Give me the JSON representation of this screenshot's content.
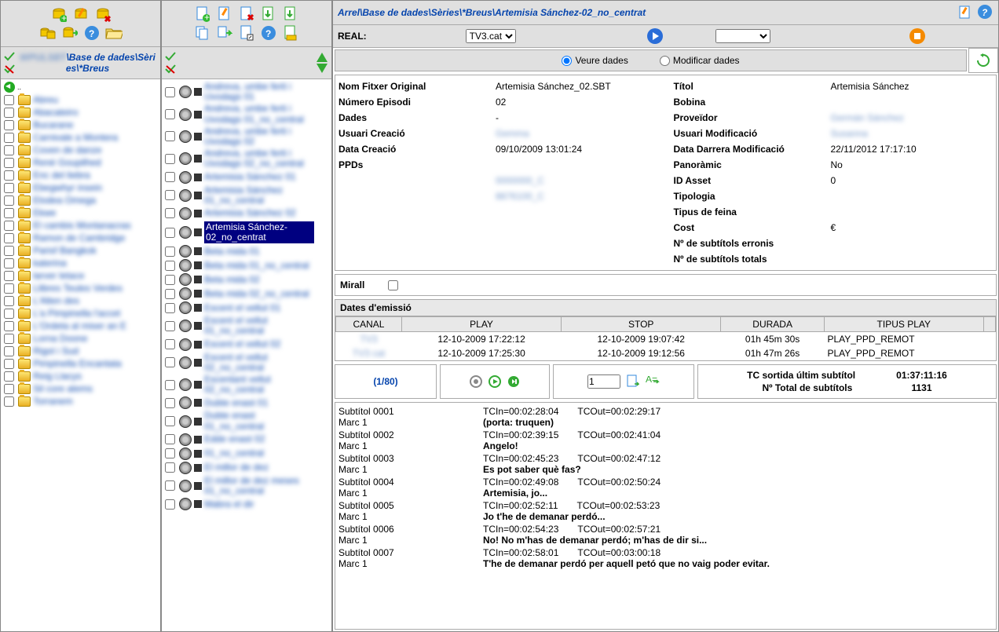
{
  "col1": {
    "path": "\\Base de dades\\Sèries\\*Breus",
    "folders": [
      "Abreu",
      "Abacateiro",
      "Bucarane",
      "Carnivale a Montera",
      "Coven de danze",
      "René Goupilhed",
      "Enc del liebra",
      "Ebegwhyr insein",
      "Elodea Omega",
      "Ekwe",
      "El cambis Montanacras",
      "Ramon de Cambridge",
      "Parisf Bangkok",
      "katerina",
      "larver letace",
      "Llibres Teules Verdes",
      "L'Alten des",
      "L'a Pimpinella l'accet",
      "L'Ordeta al miser an E",
      "Lorna Doone",
      "Rigol i Sud",
      "Pimpinella Encantata",
      "Reig Llacys",
      "Sil core atems",
      "Torranem"
    ]
  },
  "col2": {
    "items": [
      "Andreva, umbe ferti i Uvodags 01",
      "Andreva, umbe ferti i Uvodags 01_no_central",
      "Andreva, umbe ferti i Uvodags 02",
      "Andreva, umbe ferti i Uvodags 02_no_central",
      "Artemisia Sánchez 01",
      "Artemisia Sánchez 01_no_central",
      "Artemisia Sánchez 02",
      "Artemisia Sánchez-02_no_centrat",
      "Beta mida 01",
      "Beta mida 01_no_central",
      "Beta mida 02",
      "Beta mida 02_no_central",
      "Escent el vellut 01",
      "Escent el vellut 01_no_central",
      "Escent el vellut 02",
      "Escent el vellut 02_no_central",
      "Escentant vellut 02_no_central",
      "Dubte enast 01",
      "Dubte enast 01_no_central",
      "Edde enast 02",
      "01_no_central",
      "El millor de dez",
      "El millor de dez meses 01_no_central",
      "Mabra el dir"
    ],
    "selectedIndex": 7
  },
  "breadcrumb": "Arrel\\Base de dades\\Sèries\\*Breus\\Artemisia Sánchez-02_no_centrat",
  "real": {
    "label": "REAL:",
    "channel": "TV3.cat"
  },
  "viewmode": {
    "view": "Veure dades",
    "edit": "Modificar dades"
  },
  "details": {
    "left": [
      {
        "k": "Nom Fitxer Original",
        "v": "Artemisia Sánchez_02.SBT"
      },
      {
        "k": "Número Episodi",
        "v": "02"
      },
      {
        "k": "Dades",
        "v": "-"
      },
      {
        "k": "Usuari Creació",
        "v": "Gemma",
        "blur": true
      },
      {
        "k": "Data Creació",
        "v": "09/10/2009 13:01:24"
      },
      {
        "k": "PPDs",
        "v": ""
      }
    ],
    "ppds": [
      "0000000_C",
      "8876100_C"
    ],
    "right": [
      {
        "k": "Títol",
        "v": "Artemisia Sánchez"
      },
      {
        "k": "Bobina",
        "v": ""
      },
      {
        "k": "Proveïdor",
        "v": "Germán Sánchez",
        "blur": true
      },
      {
        "k": "Usuari Modificació",
        "v": "Susanna",
        "blur": true
      },
      {
        "k": "Data Darrera Modificació",
        "v": "22/11/2012 17:17:10"
      },
      {
        "k": "Panoràmic",
        "v": "No"
      },
      {
        "k": "ID Asset",
        "v": "0"
      },
      {
        "k": "Tipologia",
        "v": ""
      },
      {
        "k": "Tipus de feina",
        "v": ""
      },
      {
        "k": "Cost",
        "v": "€"
      },
      {
        "k": "Nº de subtítols erronis",
        "v": ""
      },
      {
        "k": "Nº de subtítols totals",
        "v": ""
      }
    ]
  },
  "mirall": "Mirall",
  "emissio": {
    "title": "Dates d'emissió",
    "cols": [
      "CANAL",
      "PLAY",
      "STOP",
      "DURADA",
      "TIPUS PLAY",
      ""
    ],
    "rows": [
      {
        "canal": "TV3",
        "play": "12-10-2009 17:22:12",
        "stop": "12-10-2009 19:07:42",
        "dur": "01h 45m 30s",
        "tipus": "PLAY_PPD_REMOT"
      },
      {
        "canal": "TV3 cat",
        "play": "12-10-2009 17:25:30",
        "stop": "12-10-2009 19:12:56",
        "dur": "01h 47m 26s",
        "tipus": "PLAY_PPD_REMOT"
      }
    ]
  },
  "nav": {
    "pos": "(1/80)",
    "input": "1"
  },
  "stats": {
    "k1": "TC sortida últim subtítol",
    "v1": "01:37:11:16",
    "k2": "Nº Total de subtítols",
    "v2": "1131"
  },
  "subtitles": [
    {
      "id": "Subtítol  0001",
      "tcin": "TCIn=00:02:28:04",
      "tcout": "TCOut=00:02:29:17",
      "marc": "Marc 1",
      "txt": "(porta: truquen)"
    },
    {
      "id": "Subtítol  0002",
      "tcin": "TCIn=00:02:39:15",
      "tcout": "TCOut=00:02:41:04",
      "marc": "Marc 1",
      "txt": "Angelo!"
    },
    {
      "id": "Subtítol  0003",
      "tcin": "TCIn=00:02:45:23",
      "tcout": "TCOut=00:02:47:12",
      "marc": "Marc 1",
      "txt": "Es pot saber què fas?"
    },
    {
      "id": "Subtítol  0004",
      "tcin": "TCIn=00:02:49:08",
      "tcout": "TCOut=00:02:50:24",
      "marc": "Marc 1",
      "txt": "Artemisia, jo..."
    },
    {
      "id": "Subtítol  0005",
      "tcin": "TCIn=00:02:52:11",
      "tcout": "TCOut=00:02:53:23",
      "marc": "Marc 1",
      "txt": "Jo t'he de demanar perdó..."
    },
    {
      "id": "Subtítol  0006",
      "tcin": "TCIn=00:02:54:23",
      "tcout": "TCOut=00:02:57:21",
      "marc": "Marc 1",
      "txt": "No! No m'has de demanar perdó; m'has de dir si..."
    },
    {
      "id": "Subtítol  0007",
      "tcin": "TCIn=00:02:58:01",
      "tcout": "TCOut=00:03:00:18",
      "marc": "Marc 1",
      "txt": "T'he de demanar perdó per aquell petó que no vaig poder evitar."
    }
  ]
}
